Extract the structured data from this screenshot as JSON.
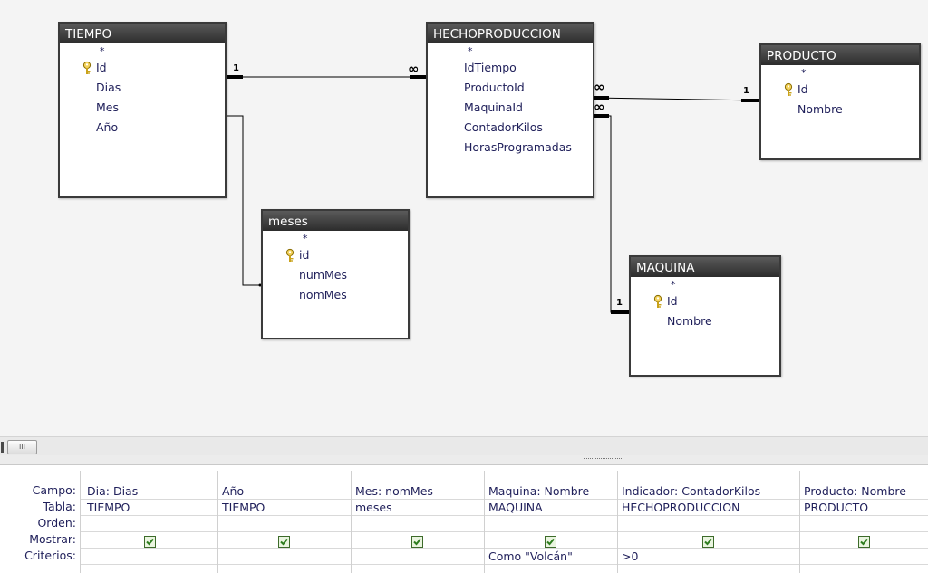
{
  "tables": {
    "tiempo": {
      "title": "TIEMPO",
      "star": "*",
      "fields": [
        "Id",
        "Dias",
        "Mes",
        "Año"
      ]
    },
    "hecho": {
      "title": "HECHOPRODUCCION",
      "star": "*",
      "fields": [
        "IdTiempo",
        "ProductoId",
        "MaquinaId",
        "ContadorKilos",
        "HorasProgramadas"
      ]
    },
    "producto": {
      "title": "PRODUCTO",
      "star": "*",
      "fields": [
        "Id",
        "Nombre"
      ]
    },
    "meses": {
      "title": "meses",
      "star": "*",
      "fields": [
        "id",
        "numMes",
        "nomMes"
      ]
    },
    "maquina": {
      "title": "MAQUINA",
      "star": "*",
      "fields": [
        "Id",
        "Nombre"
      ]
    }
  },
  "relationships": {
    "one": "1",
    "many": "∞"
  },
  "grid": {
    "row_labels": [
      "Campo:",
      "Tabla:",
      "Orden:",
      "Mostrar:",
      "Criterios:"
    ],
    "columns": [
      {
        "campo": "Dia: Dias",
        "tabla": "TIEMPO",
        "orden": "",
        "mostrar": true,
        "criterios": ""
      },
      {
        "campo": "Año",
        "tabla": "TIEMPO",
        "orden": "",
        "mostrar": true,
        "criterios": ""
      },
      {
        "campo": "Mes: nomMes",
        "tabla": "meses",
        "orden": "",
        "mostrar": true,
        "criterios": ""
      },
      {
        "campo": "Maquina: Nombre",
        "tabla": "MAQUINA",
        "orden": "",
        "mostrar": true,
        "criterios": "Como \"Volcán\""
      },
      {
        "campo": "Indicador: ContadorKilos",
        "tabla": "HECHOPRODUCCION",
        "orden": "",
        "mostrar": true,
        "criterios": ">0"
      },
      {
        "campo": "Producto: Nombre",
        "tabla": "PRODUCTO",
        "orden": "",
        "mostrar": true,
        "criterios": ""
      }
    ]
  },
  "scrollbar": {
    "thumb_label": "III"
  },
  "colors": {
    "header": "#3a3a3a",
    "text": "#1f1f5a",
    "check": "#2e7d1f",
    "canvas": "#f4f4f4"
  },
  "icons": {
    "primary_key": "key-icon",
    "checkbox": "checkbox-checked-icon"
  }
}
